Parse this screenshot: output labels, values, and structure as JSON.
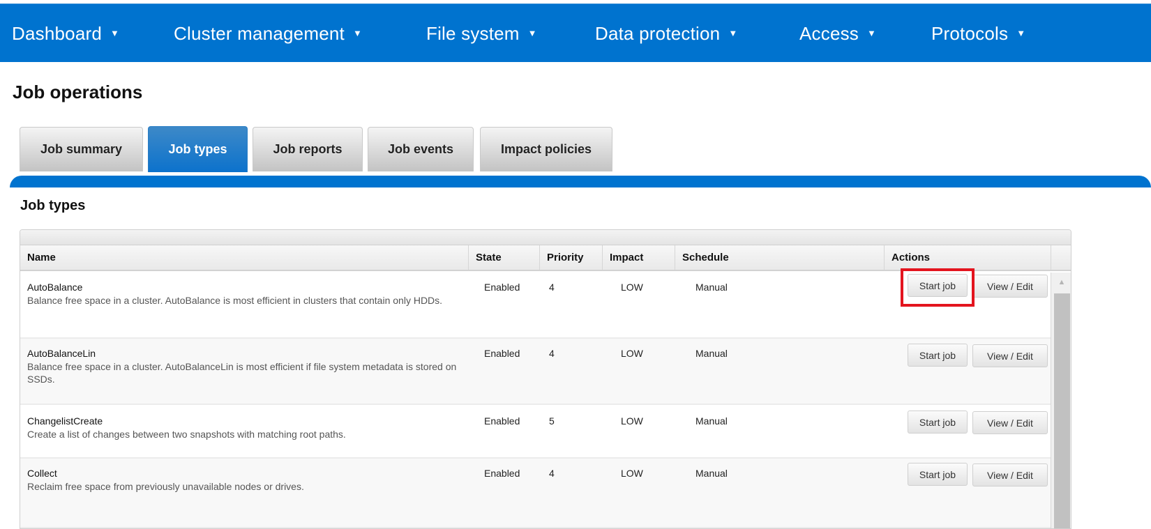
{
  "nav": {
    "items": [
      {
        "label": "Dashboard",
        "caret": "▼"
      },
      {
        "label": "Cluster management",
        "caret": "▼"
      },
      {
        "label": "File system",
        "caret": "▼"
      },
      {
        "label": "Data protection",
        "caret": "▼"
      },
      {
        "label": "Access",
        "caret": "▼"
      },
      {
        "label": "Protocols",
        "caret": "▼"
      }
    ],
    "color": "#0073cf"
  },
  "page": {
    "title": "Job operations"
  },
  "tabs": [
    {
      "label": "Job summary",
      "active": false
    },
    {
      "label": "Job types",
      "active": true
    },
    {
      "label": "Job reports",
      "active": false
    },
    {
      "label": "Job events",
      "active": false
    },
    {
      "label": "Impact policies",
      "active": false
    }
  ],
  "section": {
    "title": "Job types"
  },
  "table": {
    "columns": [
      "Name",
      "State",
      "Priority",
      "Impact",
      "Schedule",
      "Actions"
    ],
    "rows": [
      {
        "name": "AutoBalance",
        "description": "Balance free space in a cluster. AutoBalance is most efficient in clusters that contain only HDDs.",
        "state": "Enabled",
        "priority": "4",
        "impact": "LOW",
        "schedule": "Manual",
        "start_label": "Start job",
        "view_label": "View / Edit",
        "highlighted": true
      },
      {
        "name": "AutoBalanceLin",
        "description": "Balance free space in a cluster. AutoBalanceLin is most efficient if file system metadata is stored on SSDs.",
        "state": "Enabled",
        "priority": "4",
        "impact": "LOW",
        "schedule": "Manual",
        "start_label": "Start job",
        "view_label": "View / Edit",
        "highlighted": false
      },
      {
        "name": "ChangelistCreate",
        "description": "Create a list of changes between two snapshots with matching root paths.",
        "state": "Enabled",
        "priority": "5",
        "impact": "LOW",
        "schedule": "Manual",
        "start_label": "Start job",
        "view_label": "View / Edit",
        "highlighted": false
      },
      {
        "name": "Collect",
        "description": "Reclaim free space from previously unavailable nodes or drives.",
        "state": "Enabled",
        "priority": "4",
        "impact": "LOW",
        "schedule": "Manual",
        "start_label": "Start job",
        "view_label": "View / Edit",
        "highlighted": false
      }
    ]
  },
  "scrollbar": {
    "up_arrow": "▲"
  },
  "colors": {
    "brand": "#0073cf",
    "highlight": "#e3141e"
  }
}
